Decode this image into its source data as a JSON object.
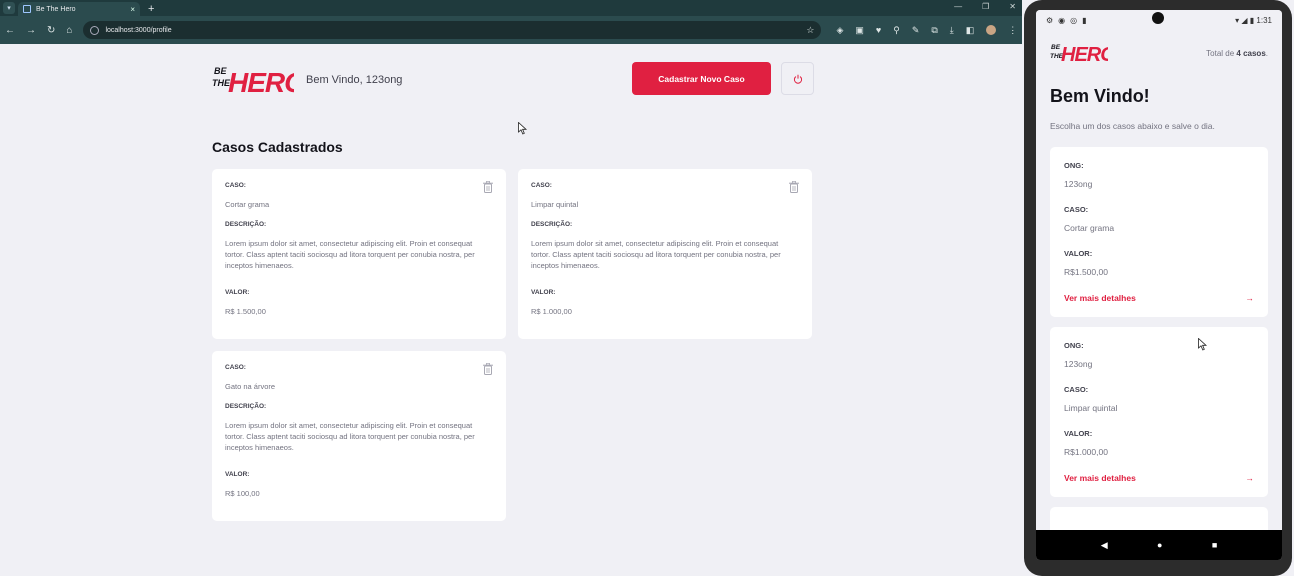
{
  "browser": {
    "tab_title": "Be The Hero",
    "url": "localhost:3000/profile"
  },
  "colors": {
    "brand": "#e02041",
    "background": "#f0f0f5",
    "chrome": "#2b4b4e"
  },
  "profile": {
    "logo_text_top": "BE",
    "logo_text_mid": "THE",
    "logo_text_main": "HERO",
    "welcome": "Bem Vindo, 123ong",
    "new_case_button": "Cadastrar Novo Caso",
    "section_title": "Casos Cadastrados",
    "labels": {
      "case": "CASO:",
      "description": "DESCRIÇÃO:",
      "value": "VALOR:"
    },
    "cases": [
      {
        "title": "Cortar grama",
        "description": "Lorem ipsum dolor sit amet, consectetur adipiscing elit. Proin et consequat tortor. Class aptent taciti sociosqu ad litora torquent per conubia nostra, per inceptos himenaeos.",
        "value": "R$ 1.500,00"
      },
      {
        "title": "Limpar quintal",
        "description": "Lorem ipsum dolor sit amet, consectetur adipiscing elit. Proin et consequat tortor. Class aptent taciti sociosqu ad litora torquent per conubia nostra, per inceptos himenaeos.",
        "value": "R$ 1.000,00"
      },
      {
        "title": "Gato na árvore",
        "description": "Lorem ipsum dolor sit amet, consectetur adipiscing elit. Proin et consequat tortor. Class aptent taciti sociosqu ad litora torquent per conubia nostra, per inceptos himenaeos.",
        "value": "R$ 100,00"
      }
    ]
  },
  "phone": {
    "time": "1:31",
    "total_prefix": "Total de ",
    "total_count": "4 casos",
    "total_suffix": ".",
    "title": "Bem Vindo!",
    "description": "Escolha um dos casos abaixo e salve o dia.",
    "labels": {
      "ong": "ONG:",
      "case": "CASO:",
      "value": "VALOR:"
    },
    "more_link": "Ver mais detalhes",
    "incidents": [
      {
        "ong": "123ong",
        "case": "Cortar grama",
        "value": "R$1.500,00"
      },
      {
        "ong": "123ong",
        "case": "Limpar quintal",
        "value": "R$1.000,00"
      }
    ]
  }
}
